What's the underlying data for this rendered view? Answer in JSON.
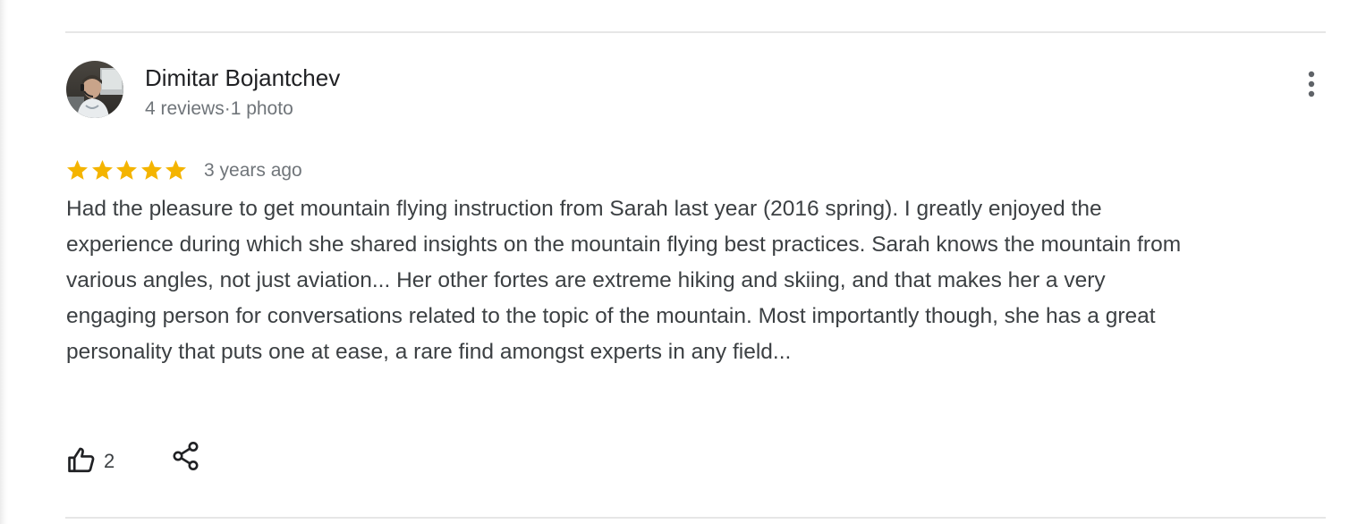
{
  "review": {
    "author": {
      "name": "Dimitar Bojantchev",
      "meta": "4 reviews·1 photo",
      "avatar_icon": "user-photo-avatar"
    },
    "rating": 5,
    "rating_max": 5,
    "star_color": "#f4b400",
    "time_ago": "3 years ago",
    "text": "Had the pleasure to get mountain flying instruction from Sarah last year (2016 spring). I greatly enjoyed the experience during which she shared insights on the mountain flying best practices. Sarah knows the mountain from various angles, not just aviation... Her other fortes are extreme hiking and skiing, and that makes her a very engaging person for conversations related to the topic of the mountain. Most importantly though, she has a great personality that puts one at ease, a rare find amongst experts in any field...",
    "likes": "2",
    "icons": {
      "more": "more-vertical-icon",
      "like": "thumbs-up-icon",
      "share": "share-icon"
    }
  }
}
